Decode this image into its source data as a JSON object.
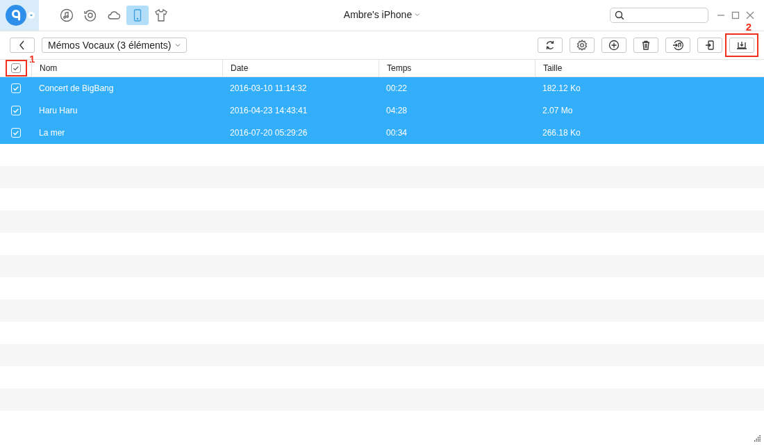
{
  "nav_icons": [
    {
      "selected": false
    },
    {
      "selected": false
    },
    {
      "selected": false
    },
    {
      "selected": true
    },
    {
      "selected": false
    }
  ],
  "device": {
    "title": "Ambre's iPhone"
  },
  "category": {
    "label": "Mémos Vocaux (3 éléments)"
  },
  "toolbar_buttons": [
    {
      "highlighted": false
    },
    {
      "highlighted": false
    },
    {
      "highlighted": false
    },
    {
      "highlighted": false
    },
    {
      "highlighted": false
    },
    {
      "highlighted": false
    },
    {
      "highlighted": true,
      "annotation": "2"
    }
  ],
  "table": {
    "select_all": {
      "checked": true,
      "annotation": "1"
    },
    "columns": [
      "Nom",
      "Date",
      "Temps",
      "Taille"
    ],
    "rows": [
      {
        "cells": [
          "Concert de BigBang",
          "2016-03-10 11:14:32",
          "00:22",
          "182.12 Ko"
        ],
        "checked": true,
        "selected": true
      },
      {
        "cells": [
          "Haru Haru",
          "2016-04-23 14:43:41",
          "04:28",
          "2.07 Mo"
        ],
        "checked": true,
        "selected": true
      },
      {
        "cells": [
          "La mer",
          "2016-07-20 05:29:26",
          "00:34",
          "266.18 Ko"
        ],
        "checked": true,
        "selected": true
      }
    ]
  }
}
